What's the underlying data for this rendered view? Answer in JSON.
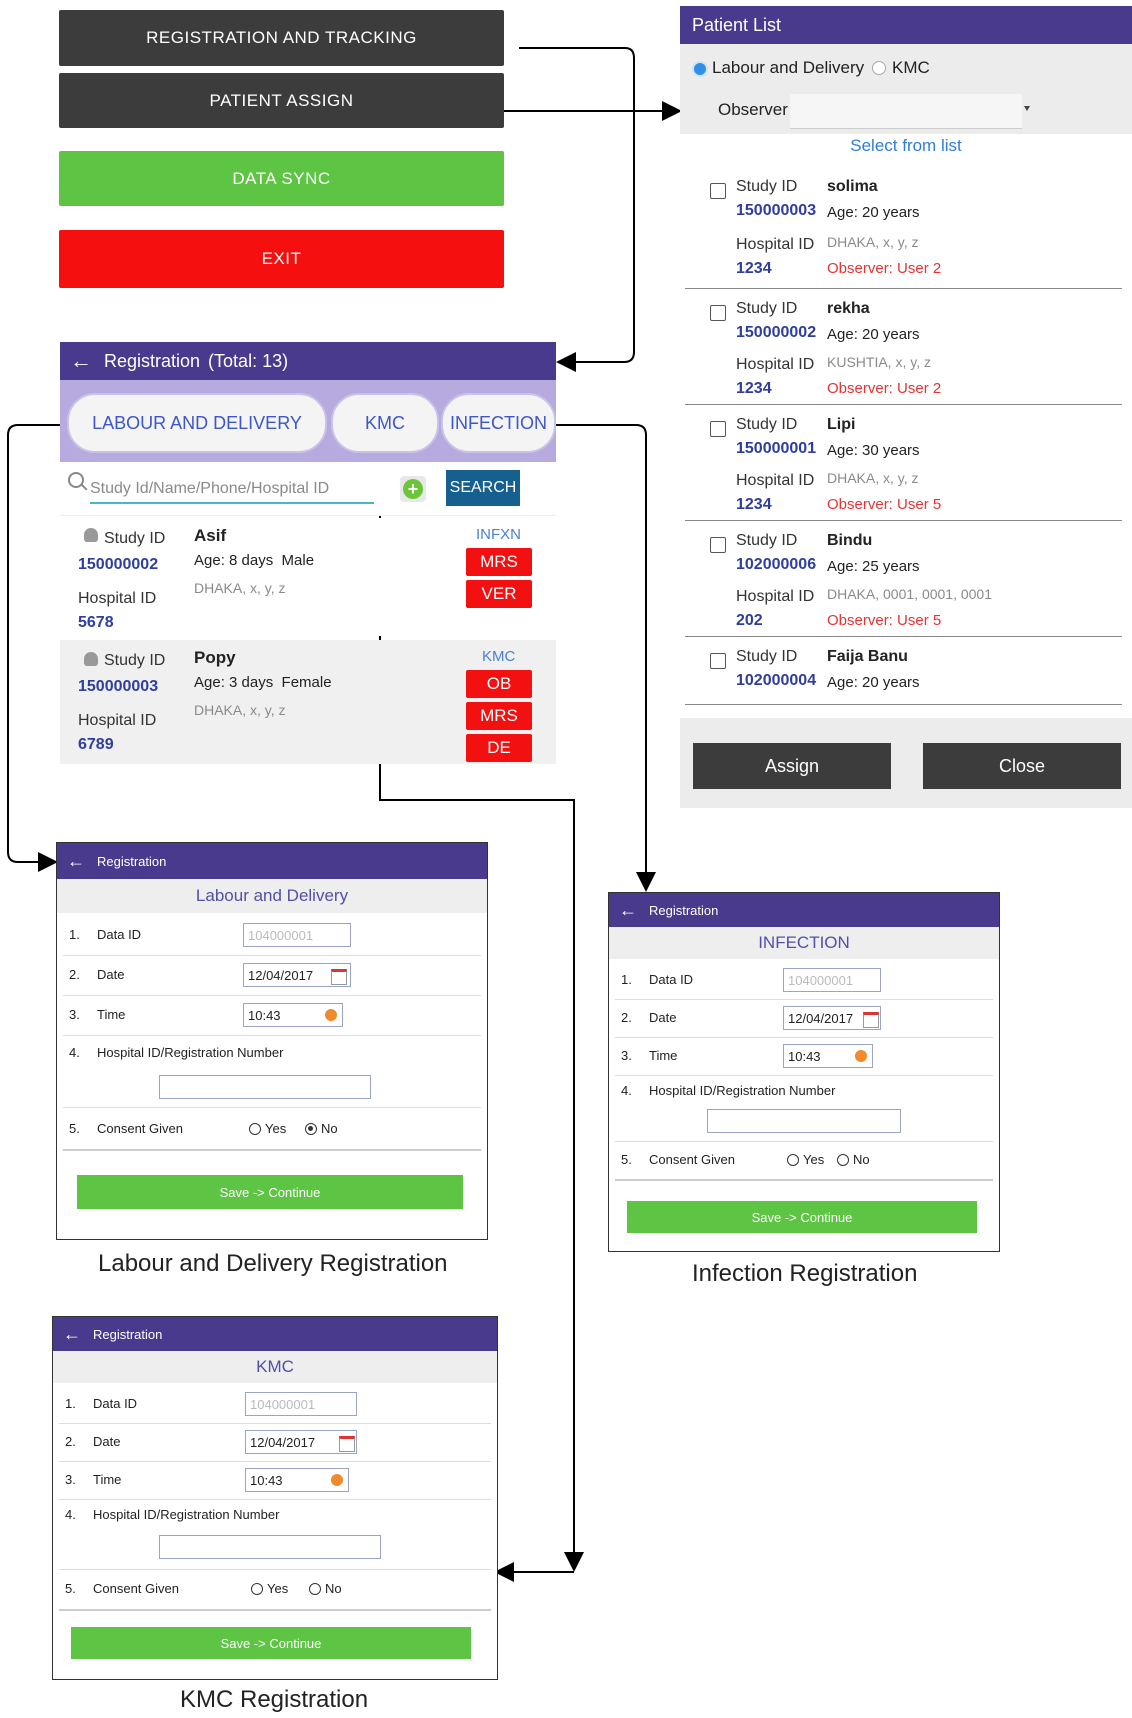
{
  "main_menu": {
    "registration_tracking": "REGISTRATION AND TRACKING",
    "patient_assign": "PATIENT ASSIGN",
    "data_sync": "DATA SYNC",
    "exit": "EXIT"
  },
  "registration": {
    "title": "Registration",
    "total": "(Total: 13)",
    "tabs": [
      "LABOUR AND DELIVERY",
      "KMC",
      "INFECTION"
    ],
    "search_placeholder": "Study Id/Name/Phone/Hospital ID",
    "search_button": "SEARCH",
    "rows": [
      {
        "study_id_label": "Study ID",
        "study_id": "150000002",
        "hospital_id_label": "Hospital ID",
        "hospital_id": "5678",
        "name": "Asif",
        "age_sex": "Age: 8 days  Male",
        "address": "DHAKA, x, y, z",
        "type": "INFXN",
        "badges": [
          "MRS",
          "VER"
        ]
      },
      {
        "study_id_label": "Study ID",
        "study_id": "150000003",
        "hospital_id_label": "Hospital ID",
        "hospital_id": "6789",
        "name": "Popy",
        "age_sex": "Age: 3 days  Female",
        "address": "DHAKA, x, y, z",
        "type": "KMC",
        "badges": [
          "OB",
          "MRS",
          "DE"
        ]
      }
    ]
  },
  "patient_list": {
    "title": "Patient List",
    "radio_options": [
      "Labour and Delivery",
      "KMC"
    ],
    "observer_label": "Observer",
    "select_hint": "Select from list",
    "rows": [
      {
        "study_id": "150000003",
        "name": "solima",
        "age": "Age: 20 years",
        "hospital_id": "1234",
        "address": "DHAKA, x, y, z",
        "observer": "Observer: User 2"
      },
      {
        "study_id": "150000002",
        "name": "rekha",
        "age": "Age: 20 years",
        "hospital_id": "1234",
        "address": "KUSHTIA, x, y, z",
        "observer": "Observer: User 2"
      },
      {
        "study_id": "150000001",
        "name": "Lipi",
        "age": "Age: 30 years",
        "hospital_id": "1234",
        "address": "DHAKA, x, y, z",
        "observer": "Observer: User 5"
      },
      {
        "study_id": "102000006",
        "name": "Bindu",
        "age": "Age: 25 years",
        "hospital_id": "202",
        "address": "DHAKA, 0001, 0001, 0001",
        "observer": "Observer: User 5"
      },
      {
        "study_id": "102000004",
        "name": "Faija Banu",
        "age": "Age: 20 years"
      }
    ],
    "study_id_label": "Study ID",
    "hospital_id_label": "Hospital ID",
    "assign_button": "Assign",
    "close_button": "Close"
  },
  "forms": {
    "header": "Registration",
    "labels": {
      "data_id": "Data ID",
      "date": "Date",
      "time": "Time",
      "hospital_reg": "Hospital ID/Registration Number",
      "consent": "Consent Given",
      "yes": "Yes",
      "no": "No",
      "save": "Save -> Continue"
    },
    "numbers": [
      "1.",
      "2.",
      "3.",
      "4.",
      "5."
    ],
    "values": {
      "data_id": "104000001",
      "date": "12/04/2017",
      "time": "10:43"
    },
    "labour": {
      "subtitle": "Labour and Delivery",
      "caption": "Labour and Delivery Registration",
      "consent": "No"
    },
    "infection": {
      "subtitle": "INFECTION",
      "caption": "Infection Registration",
      "consent": ""
    },
    "kmc": {
      "subtitle": "KMC",
      "caption": "KMC Registration",
      "consent": ""
    }
  }
}
